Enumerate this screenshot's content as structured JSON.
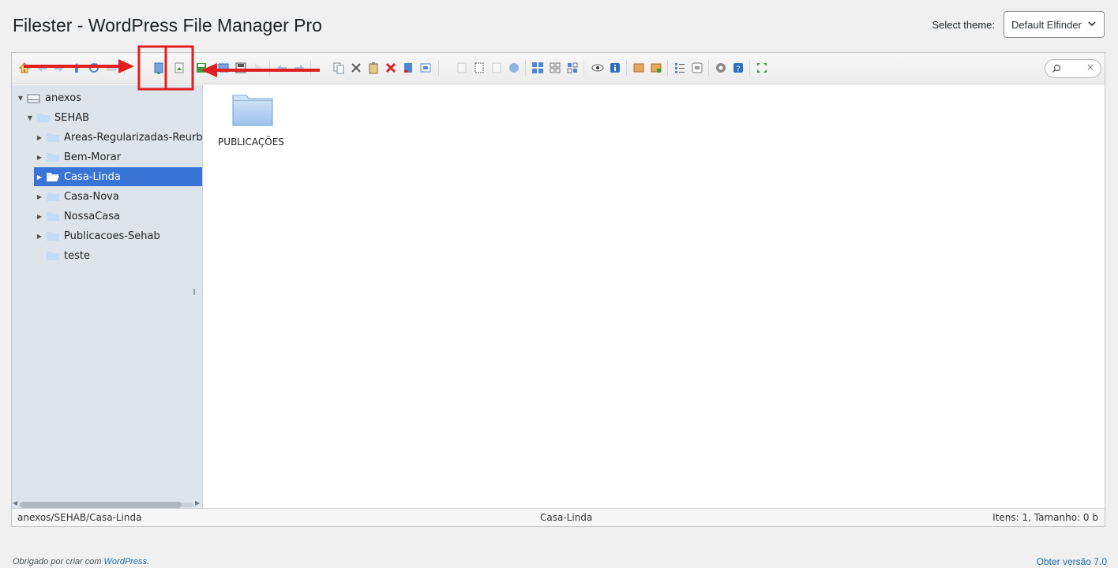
{
  "page": {
    "title": "Filester - WordPress File Manager Pro",
    "theme_label": "Select theme:",
    "theme_selected": "Default Elfinder"
  },
  "toolbar": {
    "buttons": [
      "home-icon",
      "back-icon",
      "forward-icon",
      "up-icon",
      "reload-icon",
      "netmount-icon",
      "download-icon",
      "upload-icon",
      "save-icon",
      "open-icon",
      "archive-save-icon",
      "play-icon",
      "undo-icon",
      "redo-icon",
      "copy-icon",
      "cut-icon",
      "paste-icon",
      "delete-icon",
      "empty-icon",
      "rename-icon",
      "duplicate-icon",
      "select-all-icon",
      "edit-icon",
      "resize-icon",
      "view-icons-icon",
      "view-small-icon",
      "view-grid-icon",
      "preview-icon",
      "info-icon",
      "extract-icon",
      "archive-icon",
      "view-list-icon",
      "sort-icon",
      "settings-icon",
      "help-icon",
      "fullscreen-icon"
    ],
    "search_clear": "×"
  },
  "tree": {
    "items": [
      {
        "label": "anexos",
        "level": 0
      },
      {
        "label": "SEHAB",
        "level": 1
      },
      {
        "label": "Areas-Regularizadas-Reurb",
        "level": 2
      },
      {
        "label": "Bem-Morar",
        "level": 2
      },
      {
        "label": "Casa-Linda",
        "level": 2,
        "selected": true
      },
      {
        "label": "Casa-Nova",
        "level": 2
      },
      {
        "label": "NossaCasa",
        "level": 2
      },
      {
        "label": "Publicacoes-Sehab",
        "level": 2
      },
      {
        "label": "teste",
        "level": 2
      }
    ]
  },
  "cwd": {
    "files": [
      {
        "name": "PUBLICAÇÕES",
        "type": "folder"
      }
    ]
  },
  "status": {
    "path": "anexos/SEHAB/Casa-Linda",
    "selected": "Casa-Linda",
    "size": "Itens: 1, Tamanho: 0 b"
  },
  "footer": {
    "thanks_prefix": "Obrigado por criar com ",
    "thanks_link": "WordPress",
    "thanks_suffix": ".",
    "version": "Obter versão 7.0"
  },
  "colors": {
    "selected_bg": "#3875d7",
    "annotation_red": "#e02020",
    "link": "#2271b1"
  }
}
